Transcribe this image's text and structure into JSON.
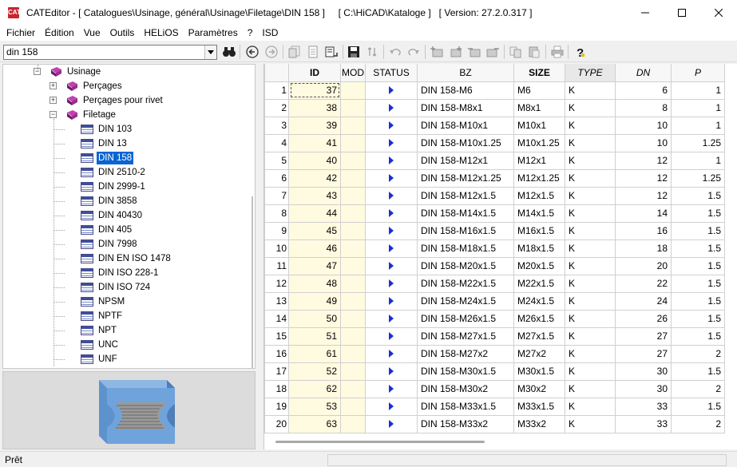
{
  "window": {
    "title": "CATEditor - [ Catalogues\\Usinage, général\\Usinage\\Filetage\\DIN 158 ]     [ C:\\HiCAD\\Kataloge ]   [ Version: 27.2.0.317 ]",
    "app_icon_text": "CAT",
    "minimize": "—",
    "maximize": "☐",
    "close": "✕"
  },
  "menu": [
    "Fichier",
    "Édition",
    "Vue",
    "Outils",
    "HELiOS",
    "Paramètres",
    "?",
    "ISD"
  ],
  "toolbar": {
    "search_value": "din 158",
    "icons": [
      "binoculars-icon",
      "back-arrow-icon",
      "forward-arrow-icon",
      "copy-page-icon",
      "page-icon",
      "new-table-icon",
      "save-icon",
      "sort-icon",
      "undo-icon",
      "redo-icon",
      "insert-row-icon",
      "insert-row-after-icon",
      "delete-row-icon",
      "delete-row-after-icon",
      "copy-icon",
      "paste-icon",
      "print-icon",
      "help-icon"
    ]
  },
  "tree": {
    "nodes": [
      {
        "label": "Usinage",
        "type": "book",
        "level": 0,
        "expander": "-"
      },
      {
        "label": "Perçages",
        "type": "book",
        "level": 1,
        "expander": "+"
      },
      {
        "label": "Perçages pour rivet",
        "type": "book",
        "level": 1,
        "expander": "+"
      },
      {
        "label": "Filetage",
        "type": "book",
        "level": 1,
        "expander": "-"
      },
      {
        "label": "DIN 103",
        "type": "table",
        "level": 2
      },
      {
        "label": "DIN 13",
        "type": "table",
        "level": 2
      },
      {
        "label": "DIN 158",
        "type": "table",
        "level": 2,
        "selected": true
      },
      {
        "label": "DIN 2510-2",
        "type": "table",
        "level": 2
      },
      {
        "label": "DIN 2999-1",
        "type": "table",
        "level": 2
      },
      {
        "label": "DIN 3858",
        "type": "table",
        "level": 2
      },
      {
        "label": "DIN 40430",
        "type": "table",
        "level": 2
      },
      {
        "label": "DIN 405",
        "type": "table",
        "level": 2
      },
      {
        "label": "DIN 7998",
        "type": "table",
        "level": 2
      },
      {
        "label": "DIN EN ISO 1478",
        "type": "table",
        "level": 2
      },
      {
        "label": "DIN ISO 228-1",
        "type": "table",
        "level": 2
      },
      {
        "label": "DIN ISO 724",
        "type": "table",
        "level": 2
      },
      {
        "label": "NPSM",
        "type": "table",
        "level": 2
      },
      {
        "label": "NPTF",
        "type": "table",
        "level": 2
      },
      {
        "label": "NPT",
        "type": "table",
        "level": 2
      },
      {
        "label": "UNC",
        "type": "table",
        "level": 2
      },
      {
        "label": "UNF",
        "type": "table",
        "level": 2
      }
    ]
  },
  "grid": {
    "columns": [
      {
        "key": "rn",
        "label": ""
      },
      {
        "key": "id",
        "label": "ID"
      },
      {
        "key": "mod",
        "label": "MOD"
      },
      {
        "key": "status",
        "label": "STATUS"
      },
      {
        "key": "bz",
        "label": "BZ"
      },
      {
        "key": "size",
        "label": "SIZE"
      },
      {
        "key": "type",
        "label": "TYPE"
      },
      {
        "key": "dn",
        "label": "DN"
      },
      {
        "key": "p",
        "label": "P"
      }
    ],
    "rows": [
      {
        "rn": "1",
        "id": "37",
        "bz": "DIN 158-M6",
        "size": "M6",
        "type": "K",
        "dn": "6",
        "p": "1"
      },
      {
        "rn": "2",
        "id": "38",
        "bz": "DIN 158-M8x1",
        "size": "M8x1",
        "type": "K",
        "dn": "8",
        "p": "1"
      },
      {
        "rn": "3",
        "id": "39",
        "bz": "DIN 158-M10x1",
        "size": "M10x1",
        "type": "K",
        "dn": "10",
        "p": "1"
      },
      {
        "rn": "4",
        "id": "41",
        "bz": "DIN 158-M10x1.25",
        "size": "M10x1.25",
        "type": "K",
        "dn": "10",
        "p": "1.25"
      },
      {
        "rn": "5",
        "id": "40",
        "bz": "DIN 158-M12x1",
        "size": "M12x1",
        "type": "K",
        "dn": "12",
        "p": "1"
      },
      {
        "rn": "6",
        "id": "42",
        "bz": "DIN 158-M12x1.25",
        "size": "M12x1.25",
        "type": "K",
        "dn": "12",
        "p": "1.25"
      },
      {
        "rn": "7",
        "id": "43",
        "bz": "DIN 158-M12x1.5",
        "size": "M12x1.5",
        "type": "K",
        "dn": "12",
        "p": "1.5"
      },
      {
        "rn": "8",
        "id": "44",
        "bz": "DIN 158-M14x1.5",
        "size": "M14x1.5",
        "type": "K",
        "dn": "14",
        "p": "1.5"
      },
      {
        "rn": "9",
        "id": "45",
        "bz": "DIN 158-M16x1.5",
        "size": "M16x1.5",
        "type": "K",
        "dn": "16",
        "p": "1.5"
      },
      {
        "rn": "10",
        "id": "46",
        "bz": "DIN 158-M18x1.5",
        "size": "M18x1.5",
        "type": "K",
        "dn": "18",
        "p": "1.5"
      },
      {
        "rn": "11",
        "id": "47",
        "bz": "DIN 158-M20x1.5",
        "size": "M20x1.5",
        "type": "K",
        "dn": "20",
        "p": "1.5"
      },
      {
        "rn": "12",
        "id": "48",
        "bz": "DIN 158-M22x1.5",
        "size": "M22x1.5",
        "type": "K",
        "dn": "22",
        "p": "1.5"
      },
      {
        "rn": "13",
        "id": "49",
        "bz": "DIN 158-M24x1.5",
        "size": "M24x1.5",
        "type": "K",
        "dn": "24",
        "p": "1.5"
      },
      {
        "rn": "14",
        "id": "50",
        "bz": "DIN 158-M26x1.5",
        "size": "M26x1.5",
        "type": "K",
        "dn": "26",
        "p": "1.5"
      },
      {
        "rn": "15",
        "id": "51",
        "bz": "DIN 158-M27x1.5",
        "size": "M27x1.5",
        "type": "K",
        "dn": "27",
        "p": "1.5"
      },
      {
        "rn": "16",
        "id": "61",
        "bz": "DIN 158-M27x2",
        "size": "M27x2",
        "type": "K",
        "dn": "27",
        "p": "2"
      },
      {
        "rn": "17",
        "id": "52",
        "bz": "DIN 158-M30x1.5",
        "size": "M30x1.5",
        "type": "K",
        "dn": "30",
        "p": "1.5"
      },
      {
        "rn": "18",
        "id": "62",
        "bz": "DIN 158-M30x2",
        "size": "M30x2",
        "type": "K",
        "dn": "30",
        "p": "2"
      },
      {
        "rn": "19",
        "id": "53",
        "bz": "DIN 158-M33x1.5",
        "size": "M33x1.5",
        "type": "K",
        "dn": "33",
        "p": "1.5"
      },
      {
        "rn": "20",
        "id": "63",
        "bz": "DIN 158-M33x2",
        "size": "M33x2",
        "type": "K",
        "dn": "33",
        "p": "2"
      }
    ]
  },
  "statusbar": {
    "text": "Prêt"
  }
}
